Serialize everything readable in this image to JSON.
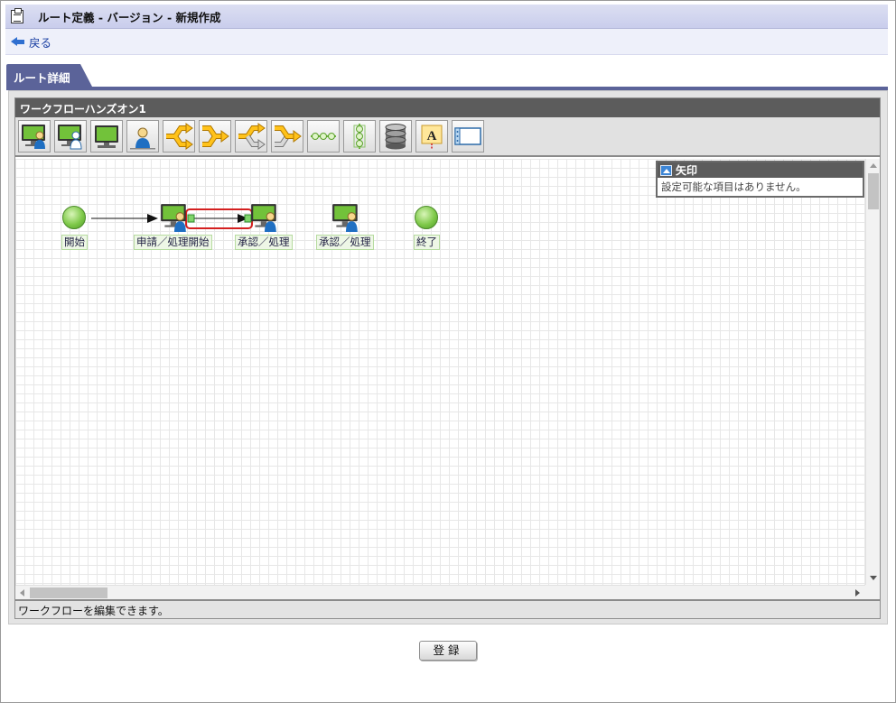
{
  "header": {
    "title": "ルート定義 - バージョン - 新規作成",
    "icon": "clipboard-icon"
  },
  "nav": {
    "back_label": "戻る",
    "back_icon": "back-arrow-icon"
  },
  "tabs": [
    {
      "label": "ルート詳細",
      "active": true
    }
  ],
  "panel": {
    "title": "ワークフローハンズオン1",
    "toolbar": [
      {
        "name": "application-node-tool",
        "icon": "monitor-user-icon"
      },
      {
        "name": "approval-node-tool",
        "icon": "monitor-user-outline-icon"
      },
      {
        "name": "system-node-tool",
        "icon": "monitor-icon"
      },
      {
        "name": "user-node-tool",
        "icon": "user-icon"
      },
      {
        "name": "branch-tool",
        "icon": "branch-arrow-icon"
      },
      {
        "name": "merge-tool",
        "icon": "merge-arrow-icon"
      },
      {
        "name": "branch-gray-tool",
        "icon": "branch-gray-arrow-icon"
      },
      {
        "name": "merge-gray-tool",
        "icon": "merge-gray-arrow-icon"
      },
      {
        "name": "horizontal-group-tool",
        "icon": "horizontal-chain-icon"
      },
      {
        "name": "vertical-group-tool",
        "icon": "vertical-chain-icon"
      },
      {
        "name": "database-tool",
        "icon": "database-icon"
      },
      {
        "name": "text-annotation-tool",
        "icon": "text-a-icon"
      },
      {
        "name": "container-tool",
        "icon": "window-icon"
      }
    ],
    "status_text": "ワークフローを編集できます。"
  },
  "diagram": {
    "nodes": [
      {
        "id": "start",
        "label": "開始",
        "kind": "start"
      },
      {
        "id": "apply",
        "label": "申請／処理開始",
        "kind": "task"
      },
      {
        "id": "approve1",
        "label": "承認／処理",
        "kind": "task"
      },
      {
        "id": "approve2",
        "label": "承認／処理",
        "kind": "task"
      },
      {
        "id": "end",
        "label": "終了",
        "kind": "end"
      }
    ],
    "edges": [
      {
        "from": "start",
        "to": "apply",
        "selected": false
      },
      {
        "from": "apply",
        "to": "approve1",
        "selected": true
      }
    ],
    "selection_color": "#d42020"
  },
  "properties": {
    "title": "矢印",
    "message": "設定可能な項目はありません。"
  },
  "actions": {
    "register_label": "登録"
  },
  "colors": {
    "tab_accent": "#5b6399",
    "node_green": "#7fc94a",
    "panel_head": "#5c5c5c"
  }
}
